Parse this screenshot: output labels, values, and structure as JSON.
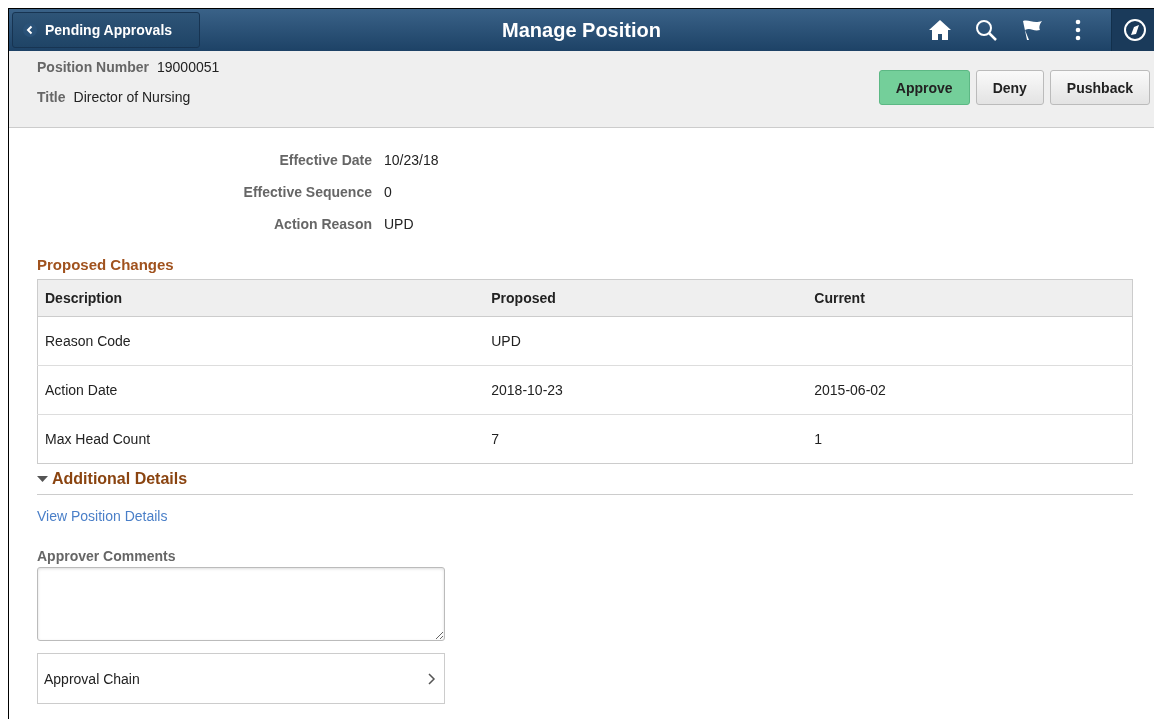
{
  "header": {
    "back_button": "Pending Approvals",
    "title": "Manage Position"
  },
  "summary": {
    "fields": [
      {
        "label": "Position Number",
        "value": "19000051"
      },
      {
        "label": "Title",
        "value": "Director of Nursing"
      }
    ],
    "buttons": [
      {
        "label": "Approve",
        "kind": "primary"
      },
      {
        "label": "Deny",
        "kind": "default"
      },
      {
        "label": "Pushback",
        "kind": "default"
      }
    ]
  },
  "details": [
    {
      "label": "Effective Date",
      "value": "10/23/18"
    },
    {
      "label": "Effective Sequence",
      "value": "0"
    },
    {
      "label": "Action Reason",
      "value": "UPD"
    }
  ],
  "proposed_changes": {
    "title": "Proposed Changes",
    "columns": [
      "Description",
      "Proposed",
      "Current"
    ],
    "rows": [
      [
        "Reason Code",
        "UPD",
        ""
      ],
      [
        "Action Date",
        "2018-10-23",
        "2015-06-02"
      ],
      [
        "Max Head Count",
        "7",
        "1"
      ]
    ]
  },
  "additional_details": {
    "title": "Additional Details",
    "expanded": true,
    "link": "View Position Details",
    "comments_label": "Approver Comments",
    "approval_chain": "Approval Chain"
  }
}
